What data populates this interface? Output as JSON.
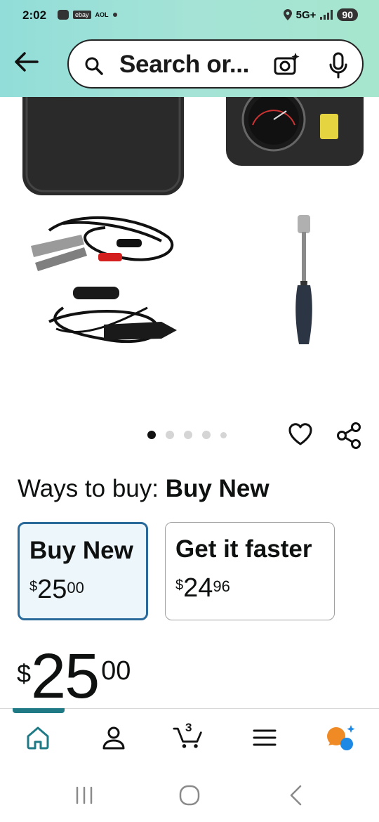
{
  "status_bar": {
    "time": "2:02",
    "notif_ebay": "ebay",
    "notif_aol": "AOL",
    "network": "5G+",
    "battery": "90"
  },
  "header": {
    "search_placeholder": "Search or...",
    "icons": [
      "back-arrow-icon",
      "search-icon",
      "camera-sparkle-icon",
      "microphone-icon"
    ]
  },
  "product": {
    "image_alt": "Tire inflator kit: carrying case, compressor with pressure gauge, clamp cables, car charger cable, nozzle adapter",
    "carousel": {
      "total_pages": 5,
      "current_page": 1
    }
  },
  "ways_to_buy": {
    "prefix": "Ways to buy:",
    "selected": "Buy New",
    "options": [
      {
        "title": "Buy New",
        "currency": "$",
        "whole": "25",
        "fraction": "00",
        "selected": true
      },
      {
        "title": "Get it faster",
        "currency": "$",
        "whole": "24",
        "fraction": "96",
        "selected": false
      }
    ]
  },
  "price": {
    "currency": "$",
    "whole": "25",
    "fraction": "00"
  },
  "bottom_nav": {
    "items": [
      "home-icon",
      "account-icon",
      "cart-icon",
      "menu-icon",
      "rufus-ai-icon"
    ],
    "cart_count": "3",
    "active": "home"
  },
  "colors": {
    "header_gradient_start": "#92ddd9",
    "header_gradient_end": "#a6e6ce",
    "selected_option_border": "#2a6a9b",
    "selected_option_bg": "#edf6fb",
    "nav_active": "#1f7a86",
    "ai_icon_orange": "#f08a24",
    "ai_icon_blue": "#1e88e5"
  }
}
